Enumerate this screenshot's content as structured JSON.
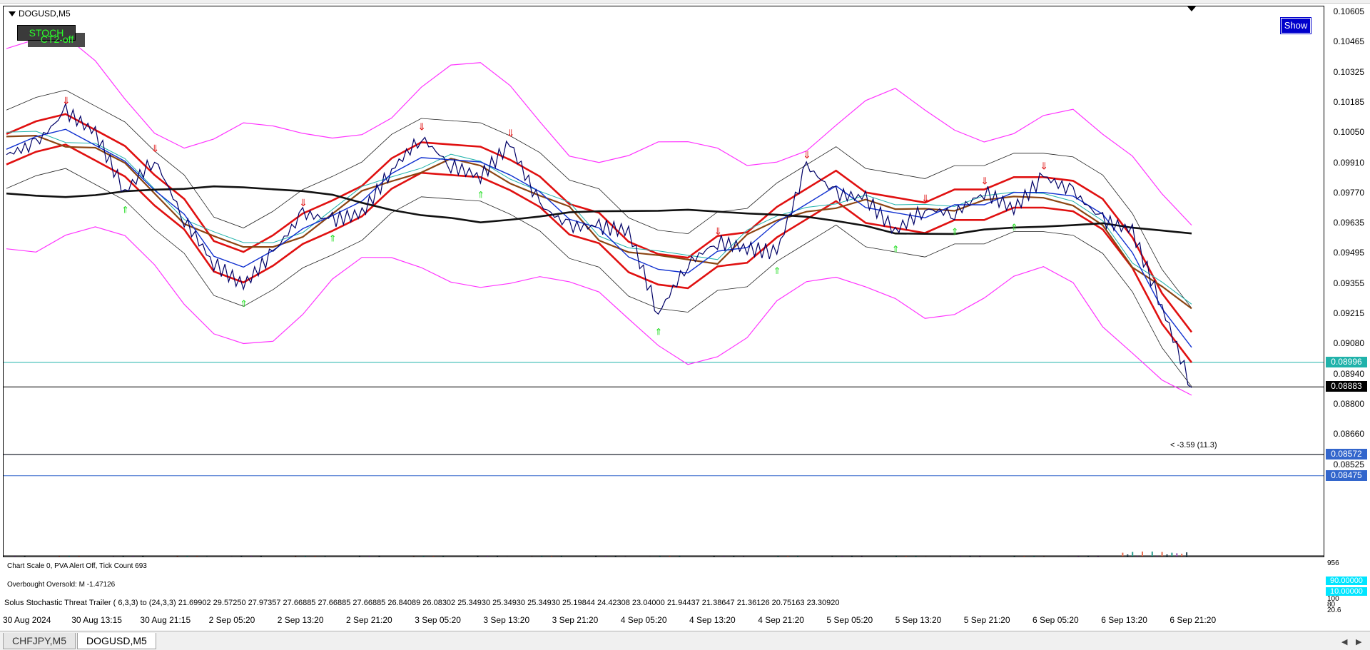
{
  "chart": {
    "symbol_label": "DOGUSD,M5",
    "stoch_button": "STOCH",
    "ct2_button": "CT2-off",
    "show_button": "Show",
    "price_note": "< -3.59 (11.3)"
  },
  "y_axis": {
    "ticks": [
      "0.10605",
      "0.10465",
      "0.10325",
      "0.10185",
      "0.10050",
      "0.09910",
      "0.09770",
      "0.09635",
      "0.09495",
      "0.09355",
      "0.09215",
      "0.09080",
      "0.08940",
      "0.08800",
      "0.08660",
      "0.08525"
    ]
  },
  "price_markers": [
    {
      "label": "0.08996",
      "color": "#20b2aa"
    },
    {
      "label": "0.08883",
      "color": "#000000"
    },
    {
      "label": "0.08572",
      "color": "#3366cc"
    },
    {
      "label": "0.08475",
      "color": "#3366cc"
    }
  ],
  "indicators": {
    "volume_panel_text": "Chart Scale  0,   PVA Alert Off,   Tick Count  693",
    "volume_axis_value": "956",
    "osc_panel_text": "Overbought Oversold:  M  -1.47126",
    "osc_upper": "90.00000",
    "osc_lower": "10.00000",
    "stoch_panel_text": "Solus Stochastic Threat Trailer ( 6,3,3) to (24,3,3) 21.69902 29.57250 27.97357 27.66885 27.66885 27.66885 26.84089 26.08302 25.34930 25.34930 25.34930 25.19844 24.42308 23.04000 21.94437 21.38647 21.36126 20.75163 23.30920",
    "stoch_axis_top": "100",
    "stoch_axis_mid": "80",
    "stoch_axis_low": "20.6"
  },
  "x_axis": {
    "labels": [
      "30 Aug 2024",
      "30 Aug 13:15",
      "30 Aug 21:15",
      "2 Sep 05:20",
      "2 Sep 13:20",
      "2 Sep 21:20",
      "3 Sep 05:20",
      "3 Sep 13:20",
      "3 Sep 21:20",
      "4 Sep 05:20",
      "4 Sep 13:20",
      "4 Sep 21:20",
      "5 Sep 05:20",
      "5 Sep 13:20",
      "5 Sep 21:20",
      "6 Sep 05:20",
      "6 Sep 13:20",
      "6 Sep 21:20"
    ]
  },
  "tabs": [
    {
      "label": "CHFJPY,M5",
      "active": false
    },
    {
      "label": "DOGUSD,M5",
      "active": true
    }
  ],
  "chart_data": {
    "type": "line",
    "ylim": [
      0.0845,
      0.1063
    ],
    "price_path": [
      {
        "x": "30 Aug 2024",
        "y": 0.0995
      },
      {
        "x": "30 Aug 09:00",
        "y": 0.1
      },
      {
        "x": "30 Aug 13:15",
        "y": 0.1015
      },
      {
        "x": "30 Aug 15:00",
        "y": 0.1005
      },
      {
        "x": "30 Aug 18:00",
        "y": 0.0978
      },
      {
        "x": "30 Aug 19:30",
        "y": 0.0993
      },
      {
        "x": "30 Aug 21:15",
        "y": 0.0965
      },
      {
        "x": "31 Aug 02:00",
        "y": 0.0945
      },
      {
        "x": "2 Sep 00:00",
        "y": 0.0935
      },
      {
        "x": "2 Sep 05:20",
        "y": 0.095
      },
      {
        "x": "2 Sep 09:00",
        "y": 0.0968
      },
      {
        "x": "2 Sep 13:20",
        "y": 0.0965
      },
      {
        "x": "2 Sep 17:00",
        "y": 0.0968
      },
      {
        "x": "2 Sep 21:20",
        "y": 0.0988
      },
      {
        "x": "3 Sep 01:00",
        "y": 0.1003
      },
      {
        "x": "3 Sep 05:20",
        "y": 0.099
      },
      {
        "x": "3 Sep 09:00",
        "y": 0.0985
      },
      {
        "x": "3 Sep 13:20",
        "y": 0.1
      },
      {
        "x": "3 Sep 15:00",
        "y": 0.0972
      },
      {
        "x": "3 Sep 18:00",
        "y": 0.0962
      },
      {
        "x": "3 Sep 21:20",
        "y": 0.0962
      },
      {
        "x": "4 Sep 01:00",
        "y": 0.096
      },
      {
        "x": "4 Sep 03:00",
        "y": 0.0922
      },
      {
        "x": "4 Sep 05:20",
        "y": 0.0945
      },
      {
        "x": "4 Sep 09:00",
        "y": 0.0955
      },
      {
        "x": "4 Sep 13:20",
        "y": 0.0952
      },
      {
        "x": "4 Sep 17:00",
        "y": 0.095
      },
      {
        "x": "4 Sep 19:00",
        "y": 0.099
      },
      {
        "x": "4 Sep 21:20",
        "y": 0.0977
      },
      {
        "x": "5 Sep 01:00",
        "y": 0.0975
      },
      {
        "x": "5 Sep 05:20",
        "y": 0.096
      },
      {
        "x": "5 Sep 09:00",
        "y": 0.097
      },
      {
        "x": "5 Sep 13:20",
        "y": 0.0968
      },
      {
        "x": "5 Sep 17:00",
        "y": 0.0978
      },
      {
        "x": "5 Sep 21:20",
        "y": 0.097
      },
      {
        "x": "6 Sep 01:00",
        "y": 0.0985
      },
      {
        "x": "6 Sep 05:20",
        "y": 0.0978
      },
      {
        "x": "6 Sep 09:00",
        "y": 0.0965
      },
      {
        "x": "6 Sep 13:20",
        "y": 0.096
      },
      {
        "x": "6 Sep 17:00",
        "y": 0.0925
      },
      {
        "x": "6 Sep 21:20",
        "y": 0.0888
      }
    ]
  }
}
